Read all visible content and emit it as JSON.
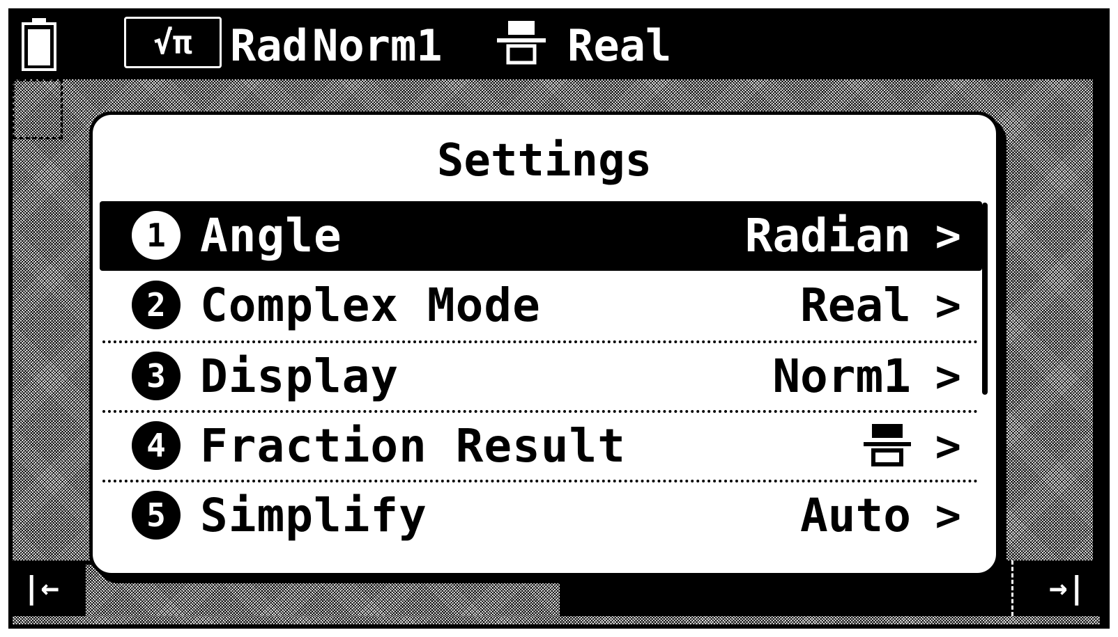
{
  "status_bar": {
    "battery_icon": "battery-icon",
    "math_mode_label": "√π",
    "angle_short": "Rad",
    "display_short": "Norm1",
    "fraction_icon": "fraction-result-icon",
    "complex_short": "Real"
  },
  "dialog": {
    "title": "Settings",
    "items": [
      {
        "number": "1",
        "label": "Angle",
        "value": "Radian",
        "selected": true
      },
      {
        "number": "2",
        "label": "Complex Mode",
        "value": "Real",
        "selected": false
      },
      {
        "number": "3",
        "label": "Display",
        "value": "Norm1",
        "selected": false
      },
      {
        "number": "4",
        "label": "Fraction Result",
        "value_icon": "fraction-result-icon",
        "selected": false
      },
      {
        "number": "5",
        "label": "Simplify",
        "value": "Auto",
        "selected": false
      }
    ],
    "chevron": ">"
  },
  "bottom_bar": {
    "prev_icon": "nav-prev-icon",
    "next_icon": "nav-next-icon"
  },
  "colors": {
    "foreground": "#000000",
    "background": "#ffffff"
  }
}
